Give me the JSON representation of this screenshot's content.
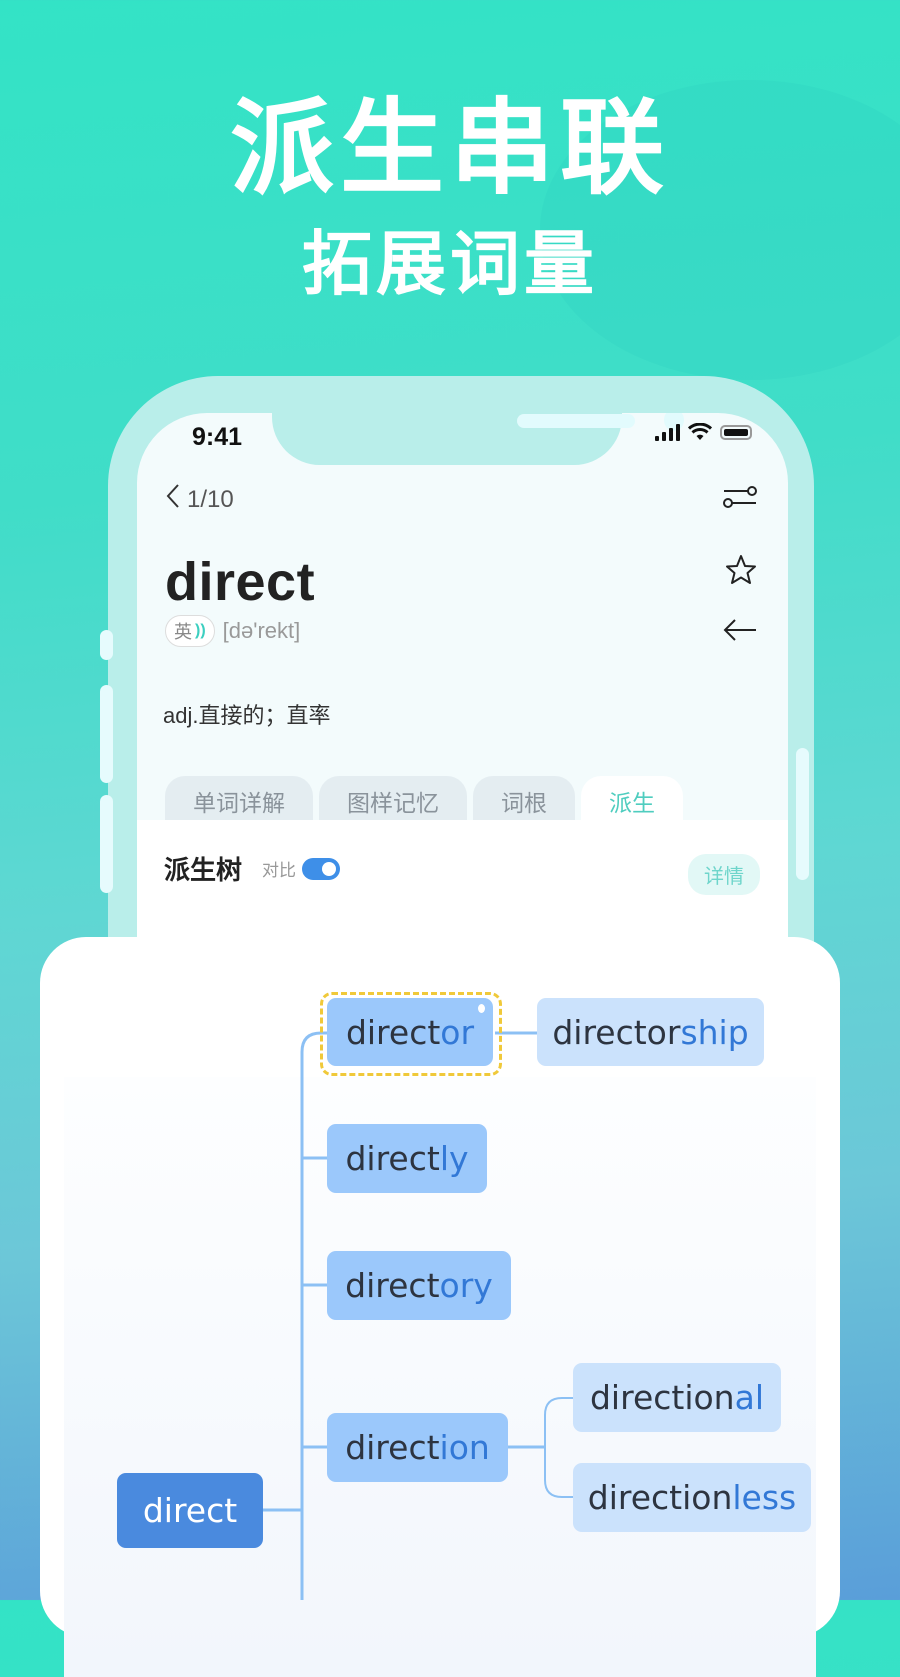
{
  "headline": {
    "title": "派生串联",
    "subtitle": "拓展词量"
  },
  "status_bar": {
    "time": "9:41"
  },
  "nav": {
    "back_icon": "chevron-left-icon",
    "page_indicator": "1/10",
    "settings_icon": "sliders-icon"
  },
  "word_card": {
    "word": "direct",
    "accent_label": "英",
    "sound_icon": "sound-wave-icon",
    "phonetic": "[də'rekt]",
    "meaning": "adj.直接的；直率",
    "star_icon": "star-outline-icon",
    "back_arrow_icon": "arrow-left-icon"
  },
  "tabs": [
    {
      "label": "单词详解",
      "active": false
    },
    {
      "label": "图样记忆",
      "active": false
    },
    {
      "label": "词根",
      "active": false
    },
    {
      "label": "派生",
      "active": true
    }
  ],
  "tree_panel": {
    "title": "派生树",
    "compare_label": "对比",
    "compare_enabled": true,
    "detail_button": "详情"
  },
  "derivation_tree": {
    "root": {
      "stem": "direct",
      "suffix": ""
    },
    "nodes": [
      {
        "stem": "direct",
        "suffix": "or",
        "level": 1,
        "selected": true
      },
      {
        "stem": "director",
        "suffix": "ship",
        "level": 2,
        "parent": "director"
      },
      {
        "stem": "direct",
        "suffix": "ly",
        "level": 1
      },
      {
        "stem": "direct",
        "suffix": "ory",
        "level": 1
      },
      {
        "stem": "direct",
        "suffix": "ion",
        "level": 1
      },
      {
        "stem": "direction",
        "suffix": "al",
        "level": 2,
        "parent": "direction"
      },
      {
        "stem": "direction",
        "suffix": "less",
        "level": 2,
        "parent": "direction"
      }
    ]
  }
}
